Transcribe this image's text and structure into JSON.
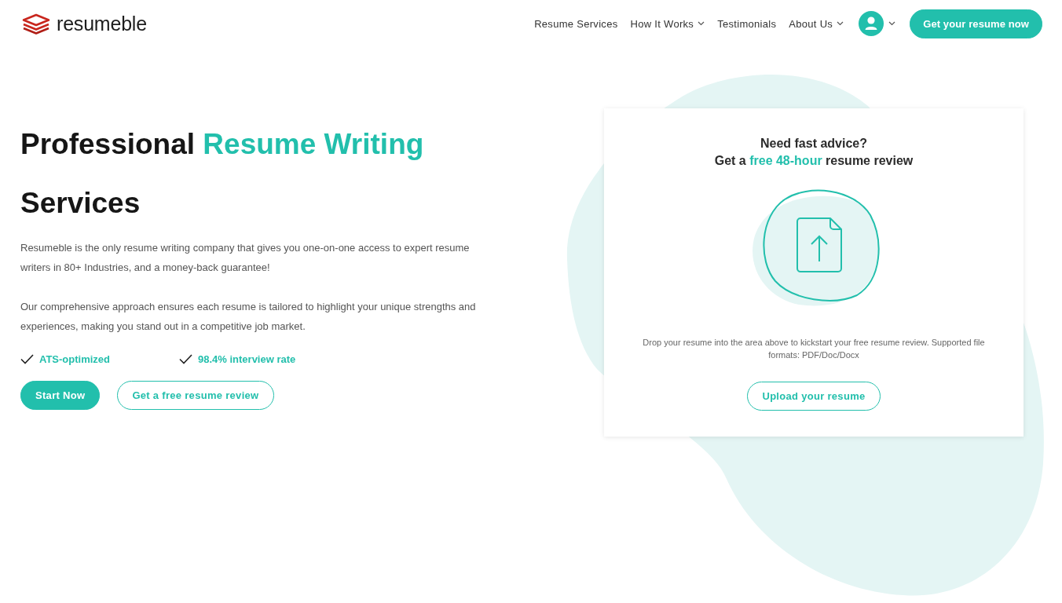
{
  "header": {
    "logo": {
      "text": "resumeble"
    },
    "nav": [
      {
        "label": "Resume Services",
        "has_menu": false
      },
      {
        "label": "How It Works",
        "has_menu": true
      },
      {
        "label": "Testimonials",
        "has_menu": false
      },
      {
        "label": "About Us",
        "has_menu": true
      }
    ],
    "account": {
      "has_menu": true
    },
    "cta": {
      "label": "Get your resume now"
    }
  },
  "hero": {
    "title": [
      {
        "text": "Professional",
        "highlight": false
      },
      {
        "text": "Resume Writing",
        "highlight": true
      },
      {
        "text": "Services",
        "highlight": false
      }
    ],
    "paragraphs": [
      "Resumeble is the only resume writing company that gives you one-on-one access to expert resume writers in 80+ Industries, and a money-back guarantee!",
      "Our comprehensive approach ensures each resume is tailored to highlight your unique strengths and experiences, making you stand out in a competitive job market."
    ],
    "features": [
      {
        "label": "ATS-optimized"
      },
      {
        "label": "98.4% interview rate"
      }
    ],
    "buttons": [
      {
        "label": "Start Now",
        "kind": "primary"
      },
      {
        "label": "Get a free resume review",
        "kind": "outline"
      }
    ]
  },
  "review_card": {
    "heading": [
      {
        "segments": [
          {
            "text": "Need fast advice?",
            "highlight": false
          }
        ]
      },
      {
        "segments": [
          {
            "text": "Get a",
            "highlight": false
          },
          {
            "text": "free 48-hour",
            "highlight": true
          },
          {
            "text": "resume review",
            "highlight": false
          }
        ]
      }
    ],
    "note": "Drop your resume into the area above to kickstart your free resume review. Supported file formats: PDF/Doc/Docx",
    "button": {
      "label": "Upload your resume",
      "kind": "outline"
    }
  }
}
